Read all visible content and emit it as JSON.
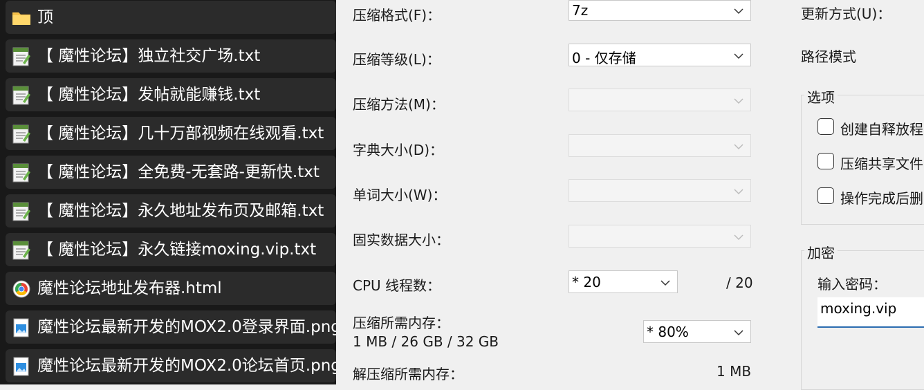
{
  "file_list": {
    "items": [
      {
        "icon": "folder-icon",
        "label": "顶"
      },
      {
        "icon": "text-file-icon",
        "label": "【 魔性论坛】独立社交广场.txt"
      },
      {
        "icon": "text-file-icon",
        "label": "【 魔性论坛】发帖就能赚钱.txt"
      },
      {
        "icon": "text-file-icon",
        "label": "【 魔性论坛】几十万部视频在线观看.txt"
      },
      {
        "icon": "text-file-icon",
        "label": "【 魔性论坛】全免费-无套路-更新快.txt"
      },
      {
        "icon": "text-file-icon",
        "label": "【 魔性论坛】永久地址发布页及邮箱.txt"
      },
      {
        "icon": "text-file-icon",
        "label": "【 魔性论坛】永久链接moxing.vip.txt"
      },
      {
        "icon": "chrome-icon",
        "label": "魔性论坛地址发布器.html"
      },
      {
        "icon": "image-file-icon",
        "label": "魔性论坛最新开发的MOX2.0登录界面.png"
      },
      {
        "icon": "image-file-icon",
        "label": "魔性论坛最新开发的MOX2.0论坛首页.png"
      }
    ]
  },
  "dialog": {
    "format_label": "压缩格式(F)：",
    "format_value": "7z",
    "level_label": "压缩等级(L)：",
    "level_value": "0 - 仅存储",
    "method_label": "压缩方法(M)：",
    "dict_label": "字典大小(D)：",
    "word_label": "单词大小(W)：",
    "solid_label": "固实数据大小：",
    "cpu_label": "CPU 线程数：",
    "cpu_value": "*  20",
    "cpu_total": "/ 20",
    "mem_label": "压缩所需内存：",
    "mem_value": "1 MB / 26 GB / 32 GB",
    "mem_percent": "*  80%",
    "decomp_label": "解压缩所需内存：",
    "decomp_value": "1 MB",
    "update_label": "更新方式(U)：",
    "path_label": "路径模式",
    "options_title": "选项",
    "opt_sfx": "创建自释放程",
    "opt_shared": "压缩共享文件",
    "opt_delete": "操作完成后删",
    "encrypt_title": "加密",
    "password_label": "输入密码：",
    "password_value": "moxing.vip"
  }
}
